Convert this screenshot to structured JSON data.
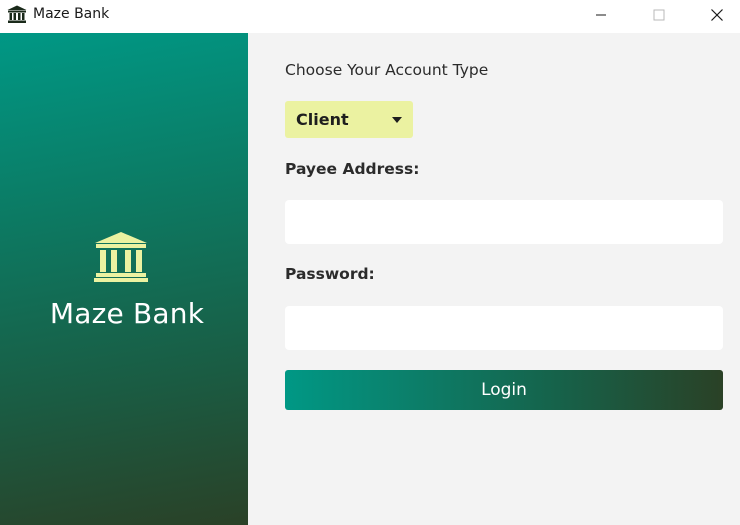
{
  "window": {
    "title": "Maze Bank",
    "icon": "bank-icon",
    "controls": [
      "minimize-icon",
      "maximize-icon",
      "close-icon"
    ]
  },
  "brand": {
    "icon": "bank-icon",
    "name": "Maze Bank"
  },
  "form": {
    "account_type_prompt": "Choose Your Account Type",
    "account_type": {
      "selected": "Client",
      "icon": "caret-down-icon"
    },
    "payee_address": {
      "label": "Payee Address:",
      "value": "",
      "placeholder": ""
    },
    "password": {
      "label": "Password:",
      "value": "",
      "placeholder": ""
    },
    "login_label": "Login"
  },
  "colors": {
    "accent_light": "#ebf2a1",
    "gradient_start": "#009885",
    "gradient_end": "#2a4126",
    "background": "#f3f3f3",
    "field_background": "#ffffff"
  }
}
